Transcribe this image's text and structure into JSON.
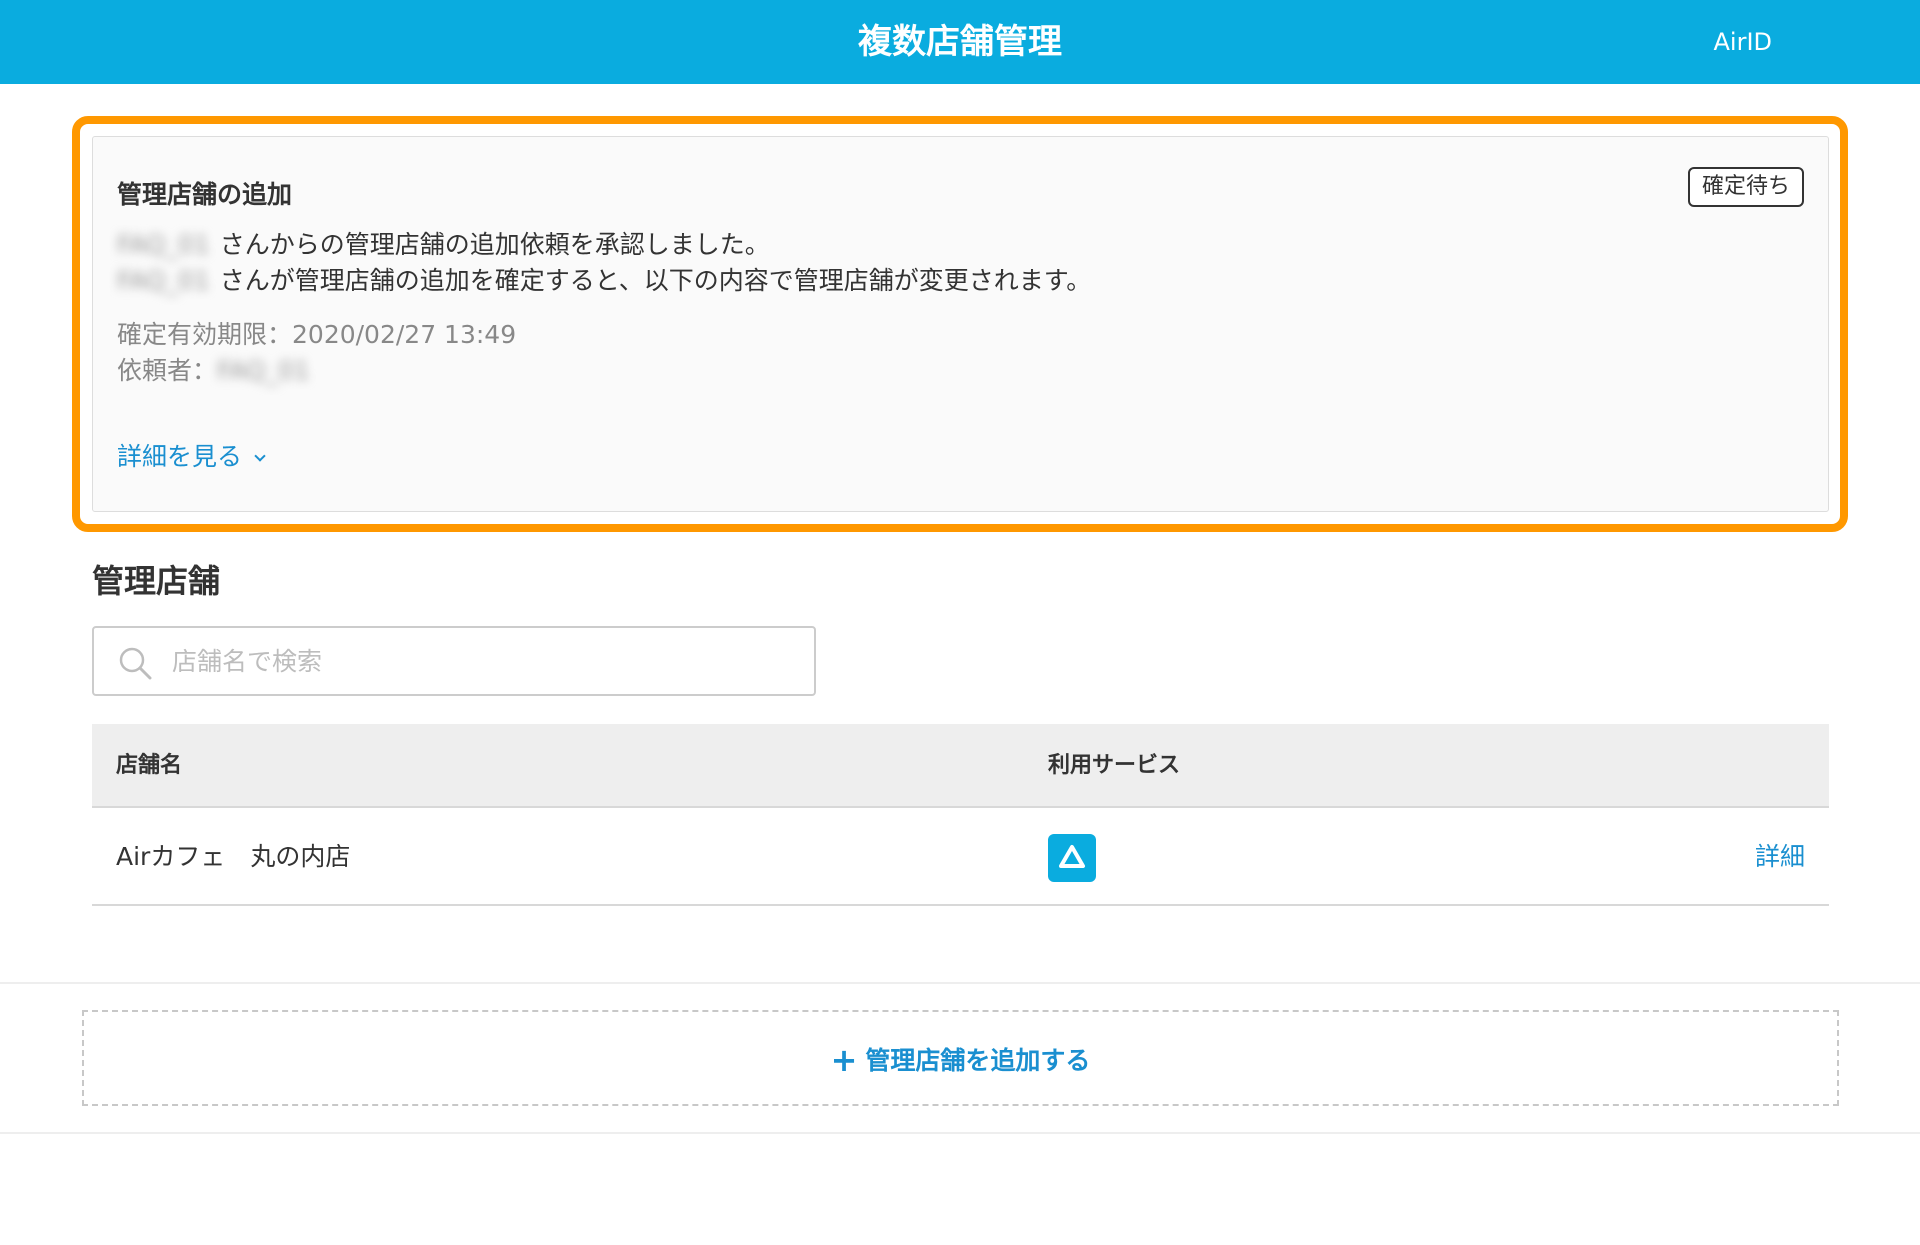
{
  "header": {
    "title": "複数店舗管理",
    "account": "AirID"
  },
  "notice": {
    "title": "管理店舗の追加",
    "status": "確定待ち",
    "requester_name": "FAQ_01",
    "line1": "さんからの管理店舗の追加依頼を承認しました。",
    "line2": "さんが管理店舗の追加を確定すると、以下の内容で管理店舗が変更されます。",
    "expiry_label": "確定有効期限：",
    "expiry_value": "2020/02/27 13:49",
    "requester_label": "依頼者：",
    "details_link": "詳細を見る"
  },
  "stores": {
    "section_title": "管理店舗",
    "search_placeholder": "店舗名で検索",
    "columns": {
      "name": "店舗名",
      "services": "利用サービス"
    },
    "rows": [
      {
        "name": "Airカフェ　丸の内店",
        "service_icon": "airregi-triangle-icon",
        "link": "詳細"
      }
    ],
    "add_button": "管理店舗を追加する",
    "add_prefix": "+"
  },
  "colors": {
    "brand": "#0aacdf",
    "highlight": "#ff9800",
    "link": "#1a8fd0"
  }
}
